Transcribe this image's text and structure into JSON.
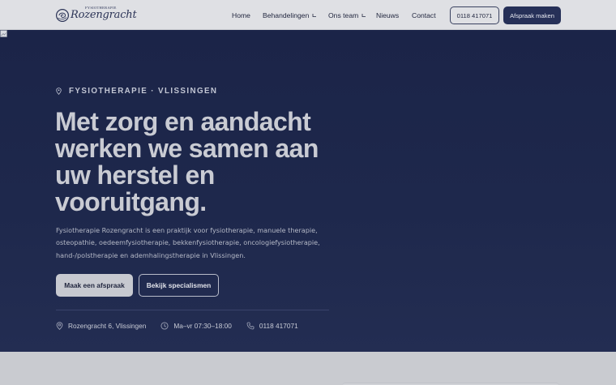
{
  "header": {
    "logo": {
      "kicker": "FYSIOTHERAPIE",
      "name": "Rozengracht"
    },
    "nav": [
      {
        "label": "Home",
        "has_dropdown": false
      },
      {
        "label": "Behandelingen",
        "has_dropdown": true
      },
      {
        "label": "Ons team",
        "has_dropdown": true
      },
      {
        "label": "Nieuws",
        "has_dropdown": false
      },
      {
        "label": "Contact",
        "has_dropdown": false
      }
    ],
    "phone_button": "0118 417071",
    "appointment_button": "Afspraak maken"
  },
  "hero": {
    "eyebrow": "FYSIOTHERAPIE · VLISSINGEN",
    "headline": "Met zorg en aandacht werken we samen aan uw herstel en vooruitgang.",
    "intro": "Fysiotherapie Rozengracht is een praktijk voor fysiotherapie, manuele therapie, osteopathie, oedeemfysiotherapie, bekkenfysiotherapie, oncologiefysiotherapie, hand-/polstherapie en ademhalingstherapie in Vlissingen.",
    "primary_button": "Maak een afspraak",
    "secondary_button": "Bekijk specialismen",
    "info": {
      "address": "Rozengracht 6, Vlissingen",
      "hours": "Ma–vr 07:30–18:00",
      "phone": "0118 417071"
    }
  },
  "colors": {
    "hero_bg": "#1e284c",
    "header_bg": "#dfe0e4",
    "accent_button": "#263058",
    "headline_text": "#c9cbd3"
  }
}
